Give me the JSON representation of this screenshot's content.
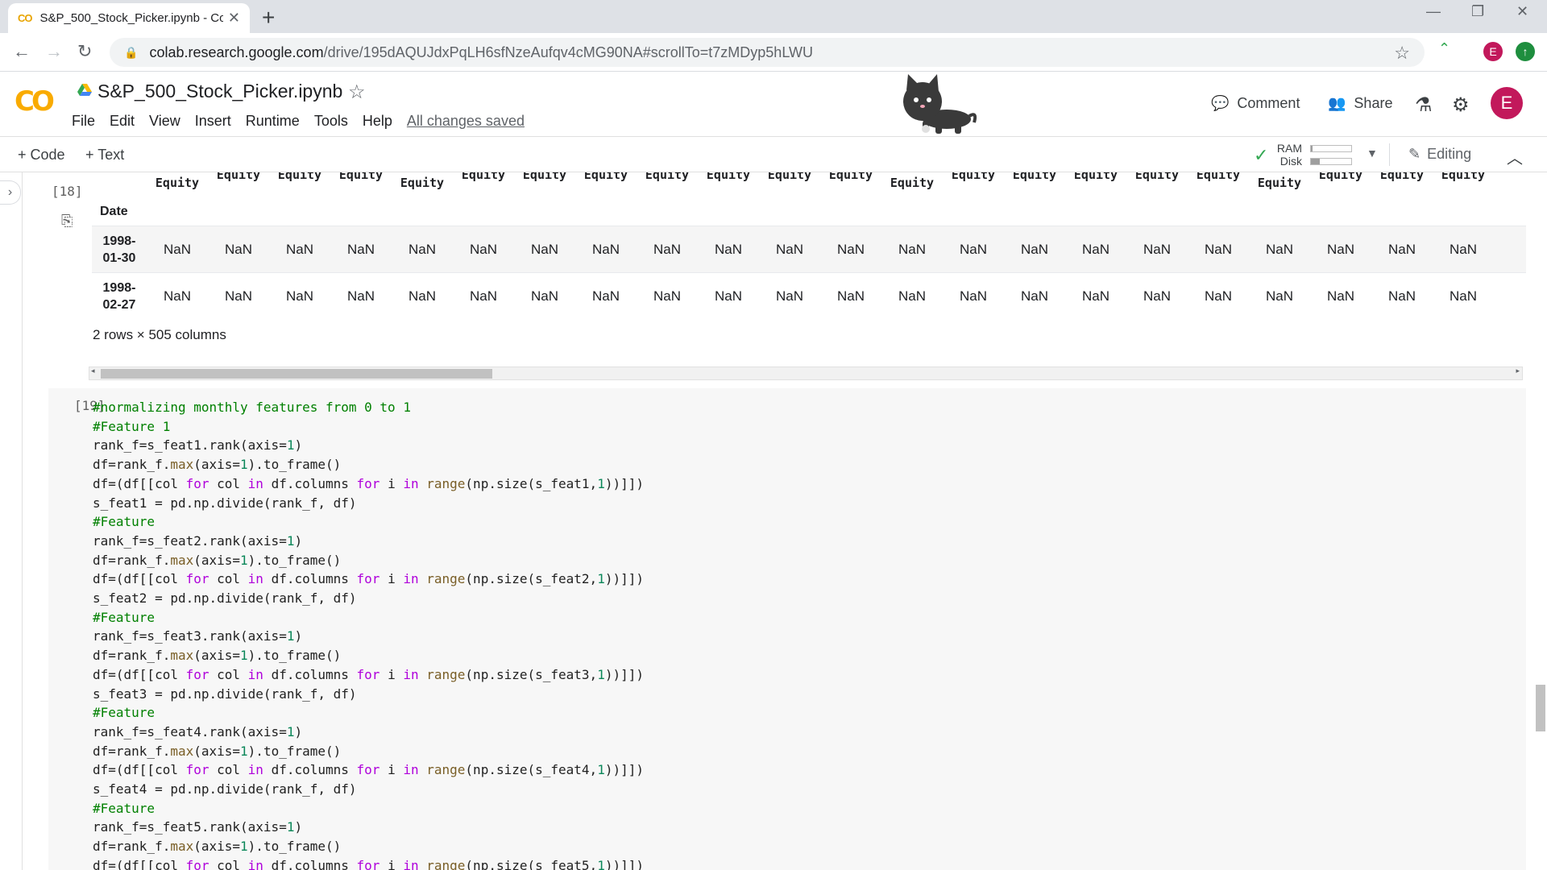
{
  "browser": {
    "tab_title": "S&P_500_Stock_Picker.ipynb - Co",
    "favicon_text": "CO",
    "url_domain": "colab.research.google.com",
    "url_path": "/drive/195dAQUJdxPqLH6sfNzeAufqv4cMG90NA#scrollTo=t7zMDyp5hLWU",
    "profile_initial": "E"
  },
  "header": {
    "logo_text": "CO",
    "notebook_title": "S&P_500_Stock_Picker.ipynb",
    "menu": [
      "File",
      "Edit",
      "View",
      "Insert",
      "Runtime",
      "Tools",
      "Help"
    ],
    "save_status": "All changes saved",
    "comment_label": "Comment",
    "share_label": "Share",
    "user_initial": "E"
  },
  "toolbar": {
    "add_code_label": "Code",
    "add_text_label": "Text",
    "ram_label": "RAM",
    "disk_label": "Disk",
    "ram_usage": 0.04,
    "disk_usage": 0.22,
    "editing_label": "Editing"
  },
  "output_cell": {
    "exec_count": "[18]",
    "column_header_text": "Equity",
    "index_name": "Date",
    "rows": [
      {
        "date_year": "1998-",
        "date_md": "01-30",
        "values": [
          "NaN",
          "NaN",
          "NaN",
          "NaN",
          "NaN",
          "NaN",
          "NaN",
          "NaN",
          "NaN",
          "NaN",
          "NaN",
          "NaN",
          "NaN",
          "NaN",
          "NaN",
          "NaN",
          "NaN",
          "NaN",
          "NaN",
          "NaN",
          "NaN",
          "NaN"
        ]
      },
      {
        "date_year": "1998-",
        "date_md": "02-27",
        "values": [
          "NaN",
          "NaN",
          "NaN",
          "NaN",
          "NaN",
          "NaN",
          "NaN",
          "NaN",
          "NaN",
          "NaN",
          "NaN",
          "NaN",
          "NaN",
          "NaN",
          "NaN",
          "NaN",
          "NaN",
          "NaN",
          "NaN",
          "NaN",
          "NaN",
          "NaN"
        ]
      }
    ],
    "shape_info": "2 rows × 505 columns",
    "hscroll_position": 0.0
  },
  "code_cell": {
    "exec_count": "[19]",
    "lines": [
      [
        [
          "com",
          "#normalizing monthly features from 0 to 1"
        ]
      ],
      [
        [
          "com",
          "#Feature 1"
        ]
      ],
      [
        [
          "t",
          "rank_f=s_feat1.rank(axis="
        ],
        [
          "num",
          "1"
        ],
        [
          "t",
          ")"
        ]
      ],
      [
        [
          "t",
          "df=rank_f."
        ],
        [
          "bi",
          "max"
        ],
        [
          "t",
          "(axis="
        ],
        [
          "num",
          "1"
        ],
        [
          "t",
          ").to_frame()"
        ]
      ],
      [
        [
          "t",
          "df=(df[[col "
        ],
        [
          "kw",
          "for"
        ],
        [
          "t",
          " col "
        ],
        [
          "kw",
          "in"
        ],
        [
          "t",
          " df.columns "
        ],
        [
          "kw",
          "for"
        ],
        [
          "t",
          " i "
        ],
        [
          "kw",
          "in"
        ],
        [
          "t",
          " "
        ],
        [
          "bi",
          "range"
        ],
        [
          "t",
          "(np.size(s_feat1,"
        ],
        [
          "num",
          "1"
        ],
        [
          "t",
          "))]])"
        ]
      ],
      [
        [
          "t",
          "s_feat1 = pd.np.divide(rank_f, df)"
        ]
      ],
      [
        [
          "com",
          "#Feature"
        ]
      ],
      [
        [
          "t",
          "rank_f=s_feat2.rank(axis="
        ],
        [
          "num",
          "1"
        ],
        [
          "t",
          ")"
        ]
      ],
      [
        [
          "t",
          "df=rank_f."
        ],
        [
          "bi",
          "max"
        ],
        [
          "t",
          "(axis="
        ],
        [
          "num",
          "1"
        ],
        [
          "t",
          ").to_frame()"
        ]
      ],
      [
        [
          "t",
          "df=(df[[col "
        ],
        [
          "kw",
          "for"
        ],
        [
          "t",
          " col "
        ],
        [
          "kw",
          "in"
        ],
        [
          "t",
          " df.columns "
        ],
        [
          "kw",
          "for"
        ],
        [
          "t",
          " i "
        ],
        [
          "kw",
          "in"
        ],
        [
          "t",
          " "
        ],
        [
          "bi",
          "range"
        ],
        [
          "t",
          "(np.size(s_feat2,"
        ],
        [
          "num",
          "1"
        ],
        [
          "t",
          "))]])"
        ]
      ],
      [
        [
          "t",
          "s_feat2 = pd.np.divide(rank_f, df)"
        ]
      ],
      [
        [
          "com",
          "#Feature"
        ]
      ],
      [
        [
          "t",
          "rank_f=s_feat3.rank(axis="
        ],
        [
          "num",
          "1"
        ],
        [
          "t",
          ")"
        ]
      ],
      [
        [
          "t",
          "df=rank_f."
        ],
        [
          "bi",
          "max"
        ],
        [
          "t",
          "(axis="
        ],
        [
          "num",
          "1"
        ],
        [
          "t",
          ").to_frame()"
        ]
      ],
      [
        [
          "t",
          "df=(df[[col "
        ],
        [
          "kw",
          "for"
        ],
        [
          "t",
          " col "
        ],
        [
          "kw",
          "in"
        ],
        [
          "t",
          " df.columns "
        ],
        [
          "kw",
          "for"
        ],
        [
          "t",
          " i "
        ],
        [
          "kw",
          "in"
        ],
        [
          "t",
          " "
        ],
        [
          "bi",
          "range"
        ],
        [
          "t",
          "(np.size(s_feat3,"
        ],
        [
          "num",
          "1"
        ],
        [
          "t",
          "))]])"
        ]
      ],
      [
        [
          "t",
          "s_feat3 = pd.np.divide(rank_f, df)"
        ]
      ],
      [
        [
          "com",
          "#Feature"
        ]
      ],
      [
        [
          "t",
          "rank_f=s_feat4.rank(axis="
        ],
        [
          "num",
          "1"
        ],
        [
          "t",
          ")"
        ]
      ],
      [
        [
          "t",
          "df=rank_f."
        ],
        [
          "bi",
          "max"
        ],
        [
          "t",
          "(axis="
        ],
        [
          "num",
          "1"
        ],
        [
          "t",
          ").to_frame()"
        ]
      ],
      [
        [
          "t",
          "df=(df[[col "
        ],
        [
          "kw",
          "for"
        ],
        [
          "t",
          " col "
        ],
        [
          "kw",
          "in"
        ],
        [
          "t",
          " df.columns "
        ],
        [
          "kw",
          "for"
        ],
        [
          "t",
          " i "
        ],
        [
          "kw",
          "in"
        ],
        [
          "t",
          " "
        ],
        [
          "bi",
          "range"
        ],
        [
          "t",
          "(np.size(s_feat4,"
        ],
        [
          "num",
          "1"
        ],
        [
          "t",
          "))]])"
        ]
      ],
      [
        [
          "t",
          "s_feat4 = pd.np.divide(rank_f, df)"
        ]
      ],
      [
        [
          "com",
          "#Feature"
        ]
      ],
      [
        [
          "t",
          "rank_f=s_feat5.rank(axis="
        ],
        [
          "num",
          "1"
        ],
        [
          "t",
          ")"
        ]
      ],
      [
        [
          "t",
          "df=rank_f."
        ],
        [
          "bi",
          "max"
        ],
        [
          "t",
          "(axis="
        ],
        [
          "num",
          "1"
        ],
        [
          "t",
          ").to_frame()"
        ]
      ],
      [
        [
          "t",
          "df=(df[[col "
        ],
        [
          "kw",
          "for"
        ],
        [
          "t",
          " col "
        ],
        [
          "kw",
          "in"
        ],
        [
          "t",
          " df.columns "
        ],
        [
          "kw",
          "for"
        ],
        [
          "t",
          " i "
        ],
        [
          "kw",
          "in"
        ],
        [
          "t",
          " "
        ],
        [
          "bi",
          "range"
        ],
        [
          "t",
          "(np.size(s_feat5,"
        ],
        [
          "num",
          "1"
        ],
        [
          "t",
          "))]])"
        ]
      ]
    ]
  },
  "icons": {
    "back": "arrow-left-icon",
    "forward": "arrow-right-icon",
    "reload": "reload-icon",
    "lock": "lock-icon",
    "bookmark": "star-icon",
    "comment": "comment-icon",
    "share": "people-icon",
    "lab": "flask-icon",
    "settings": "gear-icon",
    "editing": "pencil-icon",
    "output": "output-icon",
    "mascot": "cat-icon"
  },
  "colors": {
    "accent_orange": "#f9ab00",
    "avatar_pink": "#c2185b",
    "comment_green": "#008000",
    "keyword_purple": "#af00db",
    "number_green": "#098658",
    "builtin_brown": "#795e26",
    "ok_green": "#34a853"
  }
}
